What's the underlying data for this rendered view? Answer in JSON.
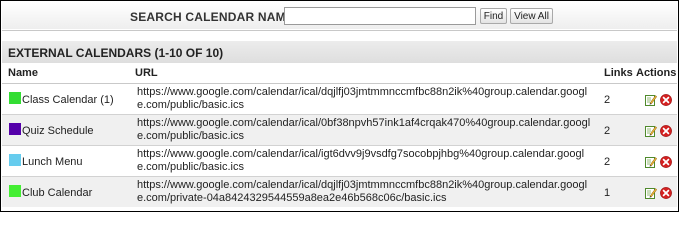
{
  "search": {
    "label": "SEARCH CALENDAR NAME:",
    "value": "",
    "placeholder": "",
    "find_label": "Find",
    "view_all_label": "View All"
  },
  "section": {
    "title": "EXTERNAL CALENDARS (1-10 OF 10)"
  },
  "table": {
    "columns": {
      "name": "Name",
      "url": "URL",
      "links": "Links",
      "actions": "Actions"
    },
    "rows": [
      {
        "color": "#33dd33",
        "name": "Class Calendar (1)",
        "url": "https://www.google.com/calendar/ical/dqjlfj03jmtmmnccmfbc88n2ik%40group.calendar.google.com/public/basic.ics",
        "links": "2"
      },
      {
        "color": "#5500aa",
        "name": "Quiz Schedule",
        "url": "https://www.google.com/calendar/ical/0bf38npvh57ink1af4crqak470%40group.calendar.google.com/public/basic.ics",
        "links": "2"
      },
      {
        "color": "#66ccee",
        "name": "Lunch Menu",
        "url": "https://www.google.com/calendar/ical/igt6dvv9j9vsdfg7socobpjhbg%40group.calendar.google.com/public/basic.ics",
        "links": "2"
      },
      {
        "color": "#44ee33",
        "name": "Club Calendar",
        "url": "https://www.google.com/calendar/ical/dqjlfj03jmtmmnccmfbc88n2ik%40group.calendar.google.com/private-04a8424329544559a8ea2e46b568c06c/basic.ics",
        "links": "1"
      }
    ]
  },
  "icons": {
    "edit": "edit-icon",
    "delete": "delete-icon"
  },
  "colors": {
    "delete_red": "#d42020",
    "header_bg": "#e4e4e4"
  }
}
